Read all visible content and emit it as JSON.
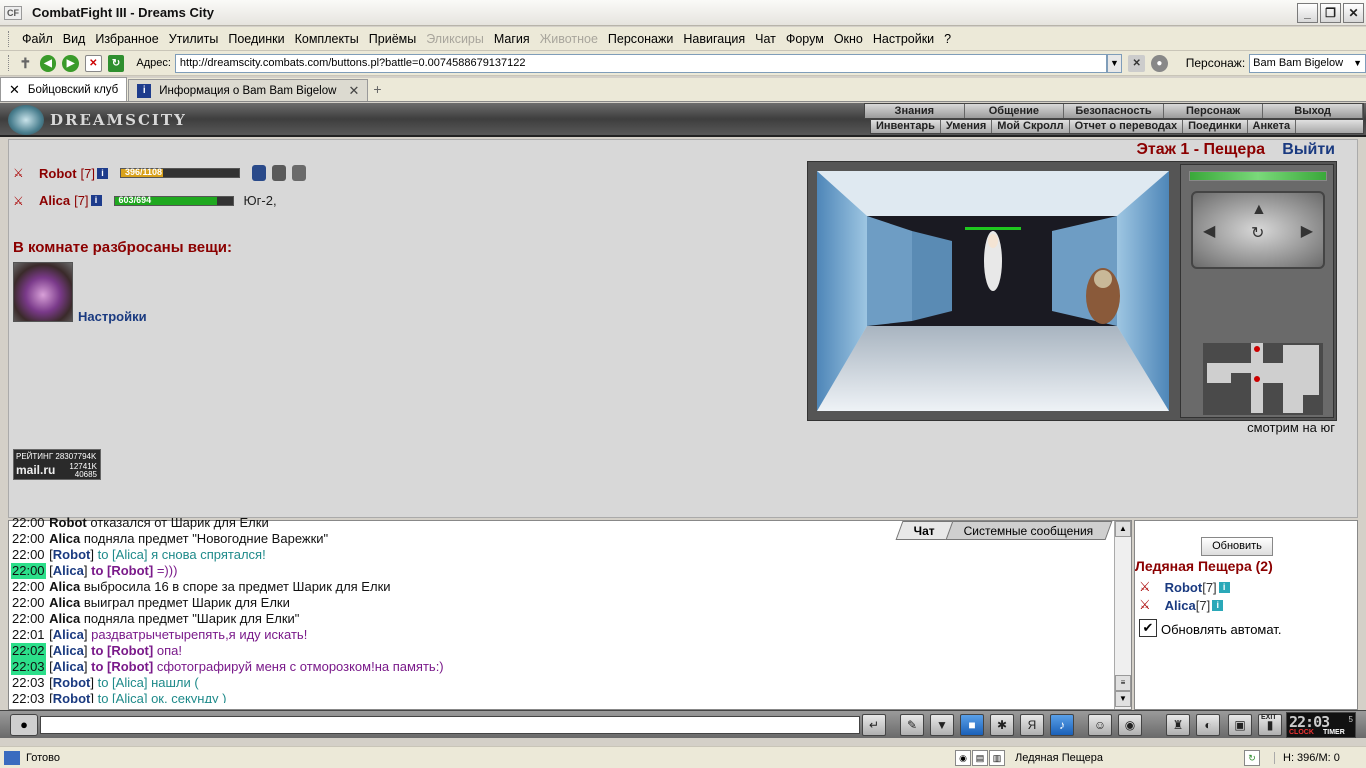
{
  "window": {
    "app_icon": "CF",
    "title": "CombatFight III - Dreams City",
    "controls": [
      "_",
      "❐",
      "✕"
    ]
  },
  "menu": [
    {
      "label": "Файл",
      "disabled": false
    },
    {
      "label": "Вид",
      "disabled": false
    },
    {
      "label": "Избранное",
      "disabled": false
    },
    {
      "label": "Утилиты",
      "disabled": false
    },
    {
      "label": "Поединки",
      "disabled": false
    },
    {
      "label": "Комплекты",
      "disabled": false
    },
    {
      "label": "Приёмы",
      "disabled": false
    },
    {
      "label": "Эликсиры",
      "disabled": true
    },
    {
      "label": "Магия",
      "disabled": false
    },
    {
      "label": "Животное",
      "disabled": true
    },
    {
      "label": "Персонажи",
      "disabled": false
    },
    {
      "label": "Навигация",
      "disabled": false
    },
    {
      "label": "Чат",
      "disabled": false
    },
    {
      "label": "Форум",
      "disabled": false
    },
    {
      "label": "Окно",
      "disabled": false
    },
    {
      "label": "Настройки",
      "disabled": false
    },
    {
      "label": "?",
      "disabled": false
    }
  ],
  "address": {
    "label": "Адрес:",
    "url": "http://dreamscity.combats.com/buttons.pl?battle=0.00745886791371​22",
    "character_label": "Персонаж:",
    "character": "Bam Bam Bigelow"
  },
  "tabs": [
    {
      "label": "Бойцовский клуб",
      "active": true
    },
    {
      "label": "Информация о Bam Bam Bigelow",
      "active": false
    }
  ],
  "game_header": {
    "logo_text": "DREAMSCITY",
    "nav_top": [
      "Знания",
      "Общение",
      "Безопасность",
      "Персонаж",
      "Выход"
    ],
    "nav_bottom": [
      "Инвентарь",
      "Умения",
      "Мой Скролл",
      "Отчет о переводах",
      "Поединки",
      "Анкета"
    ]
  },
  "players": [
    {
      "name": "Robot",
      "level": "[7]",
      "hp_text": "396/1108",
      "hp_fraction": 0.357,
      "bar_color": "#d9a21c",
      "location": ""
    },
    {
      "name": "Alica",
      "level": "[7]",
      "hp_text": "603/694",
      "hp_fraction": 0.869,
      "bar_color": "#1fa81f",
      "location": "Юг-2,"
    }
  ],
  "items_section": {
    "title": "В комнате разбросаны вещи:",
    "link": "Настройки"
  },
  "rating": {
    "line1": "РЕЙТИНГ 28307794K",
    "brand": "mail.ru",
    "stat1": "12741K",
    "stat2": "40685"
  },
  "dungeon": {
    "floor_title": "Этаж 1 - Пещера",
    "exit_label": "Выйти",
    "facing": "смотрим на юг"
  },
  "chat": {
    "tabs": [
      {
        "label": "Чат",
        "active": true
      },
      {
        "label": "Системные сообщения",
        "active": false
      }
    ],
    "lines": [
      {
        "time": "22:00",
        "hl": false,
        "from": "Robot",
        "bracket": false,
        "to": "",
        "text": "отказался от Шарик для Елки",
        "color": ""
      },
      {
        "time": "22:00",
        "hl": false,
        "from": "Alica",
        "bracket": false,
        "to": "",
        "text": "подняла предмет \"Новогодние Варежки\"",
        "color": ""
      },
      {
        "time": "22:00",
        "hl": false,
        "from": "Robot",
        "bracket": true,
        "to": "to [Alica]",
        "text": "я снова спрятался!",
        "color": "teal"
      },
      {
        "time": "22:00",
        "hl": true,
        "from": "Alica",
        "bracket": true,
        "to": "to [Robot]",
        "text": "=)))",
        "color": "purple"
      },
      {
        "time": "22:00",
        "hl": false,
        "from": "Alica",
        "bracket": false,
        "to": "",
        "text": "выбросила 16 в споре за предмет Шарик для Елки",
        "color": ""
      },
      {
        "time": "22:00",
        "hl": false,
        "from": "Alica",
        "bracket": false,
        "to": "",
        "text": "выиграл предмет Шарик для Елки",
        "color": ""
      },
      {
        "time": "22:00",
        "hl": false,
        "from": "Alica",
        "bracket": false,
        "to": "",
        "text": "подняла предмет \"Шарик для Елки\"",
        "color": ""
      },
      {
        "time": "22:01",
        "hl": false,
        "from": "Alica",
        "bracket": true,
        "to": "",
        "text": "раздватрычетырепять,я иду искать!",
        "color": "purple"
      },
      {
        "time": "22:02",
        "hl": true,
        "from": "Alica",
        "bracket": true,
        "to": "to [Robot]",
        "text": "опа!",
        "color": "purple"
      },
      {
        "time": "22:03",
        "hl": true,
        "from": "Alica",
        "bracket": true,
        "to": "to [Robot]",
        "text": "сфотографируй меня с отморозком!на память:)",
        "color": "purple"
      },
      {
        "time": "22:03",
        "hl": false,
        "from": "Robot",
        "bracket": true,
        "to": "to [Alica]",
        "text": "нашли (",
        "color": "teal"
      },
      {
        "time": "22:03",
        "hl": false,
        "from": "Robot",
        "bracket": true,
        "to": "to [Alica]",
        "text": "ок, секунду )",
        "color": "teal"
      }
    ]
  },
  "online": {
    "refresh_label": "Обновить",
    "room": "Ледяная Пещера (2)",
    "users": [
      {
        "name": "Robot",
        "level": "[7]"
      },
      {
        "name": "Alica",
        "level": "[7]"
      }
    ],
    "auto_label": "Обновлять автомат.",
    "auto_checked": true
  },
  "clock": {
    "time": "22:03",
    "seconds": "5",
    "clock_label": "CLOCK",
    "timer_label": "TIMER",
    "exit_label": "EXIT"
  },
  "status": {
    "text": "Готово",
    "location": "Ледяная Пещера",
    "hp": "H: 396/M: 0"
  }
}
